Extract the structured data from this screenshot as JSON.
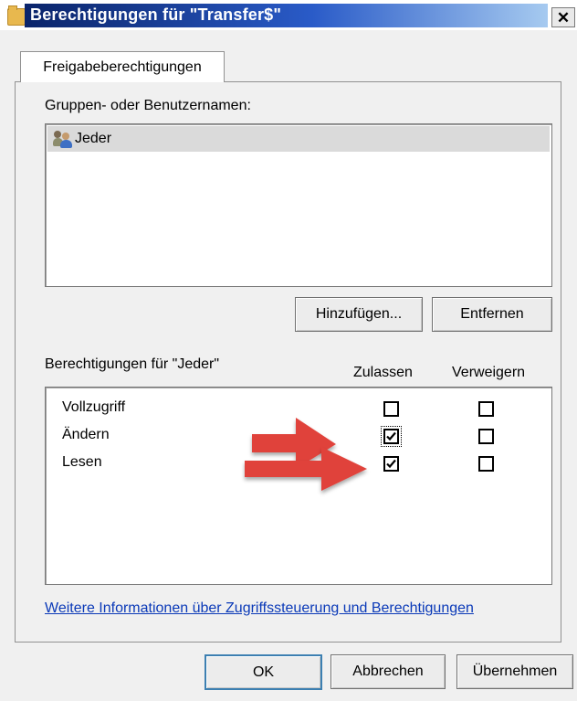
{
  "window": {
    "title": "Berechtigungen für \"Transfer$\"",
    "close_glyph": "✕"
  },
  "tabs": [
    {
      "label": "Freigabeberechtigungen",
      "selected": true
    }
  ],
  "groups": {
    "label": "Gruppen- oder Benutzernamen:",
    "items": [
      {
        "name": "Jeder",
        "icon": "users-icon",
        "selected": true
      }
    ],
    "add_button": "Hinzufügen...",
    "remove_button": "Entfernen"
  },
  "permissions": {
    "label": "Berechtigungen für \"Jeder\"",
    "col_allow": "Zulassen",
    "col_deny": "Verweigern",
    "rows": [
      {
        "name": "Vollzugriff",
        "allow": false,
        "deny": false
      },
      {
        "name": "Ändern",
        "allow": true,
        "deny": false
      },
      {
        "name": "Lesen",
        "allow": true,
        "deny": false
      }
    ]
  },
  "info_link": "Weitere Informationen über Zugriffssteuerung und Berechtigungen",
  "footer": {
    "ok": "OK",
    "cancel": "Abbrechen",
    "apply": "Übernehmen"
  },
  "colors": {
    "arrow": "#e0433b",
    "title_bar": "#0a246a",
    "link": "#0b3ab8"
  }
}
